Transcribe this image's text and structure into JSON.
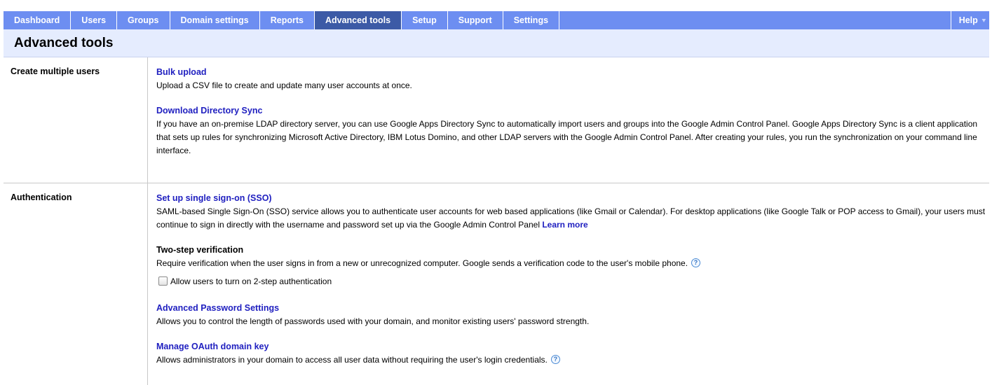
{
  "nav": {
    "tabs": [
      {
        "label": "Dashboard"
      },
      {
        "label": "Users"
      },
      {
        "label": "Groups"
      },
      {
        "label": "Domain settings"
      },
      {
        "label": "Reports"
      },
      {
        "label": "Advanced tools"
      },
      {
        "label": "Setup"
      },
      {
        "label": "Support"
      },
      {
        "label": "Settings"
      }
    ],
    "active_tab": "Advanced tools",
    "help_label": "Help"
  },
  "page": {
    "title": "Advanced tools"
  },
  "sections": [
    {
      "label": "Create multiple users",
      "items": [
        {
          "title": "Bulk upload",
          "description": "Upload a CSV file to create and update many user accounts at once."
        },
        {
          "title": "Download Directory Sync",
          "description": "If you have an on-premise LDAP directory server, you can use Google Apps Directory Sync to automatically import users and groups into the Google Admin Control Panel. Google Apps Directory Sync is a client application that sets up rules for synchronizing Microsoft Active Directory, IBM Lotus Domino, and other LDAP servers with the Google Admin Control Panel. After creating your rules, you run the synchronization on your command line interface."
        }
      ]
    },
    {
      "label": "Authentication",
      "items": [
        {
          "title": "Set up single sign-on (SSO)",
          "description": "SAML-based Single Sign-On (SSO) service allows you to authenticate user accounts for web based applications (like Gmail or Calendar). For desktop applications (like Google Talk or POP access to Gmail), your users must continue to sign in directly with the username and password set up via the Google Admin Control Panel",
          "learn_more": "Learn more"
        },
        {
          "title": "Two-step verification",
          "description": "Require verification when the user signs in from a new or unrecognized computer. Google sends a verification code to the user's mobile phone.",
          "checkbox_label": "Allow users to turn on 2-step authentication",
          "checkbox_checked": false
        },
        {
          "title": "Advanced Password Settings",
          "description": "Allows you to control the length of passwords used with your domain, and monitor existing users' password strength."
        },
        {
          "title": "Manage OAuth domain key",
          "description": "Allows administrators in your domain to access all user data without requiring the user's login credentials."
        }
      ]
    }
  ],
  "icons": {
    "help": "question-mark-icon",
    "help_menu": "chevron-down-icon"
  },
  "colors": {
    "nav_bg": "#6d8ef1",
    "nav_active": "#3c5aa6",
    "title_bg": "#e5ecfe",
    "link": "#2020c0"
  }
}
